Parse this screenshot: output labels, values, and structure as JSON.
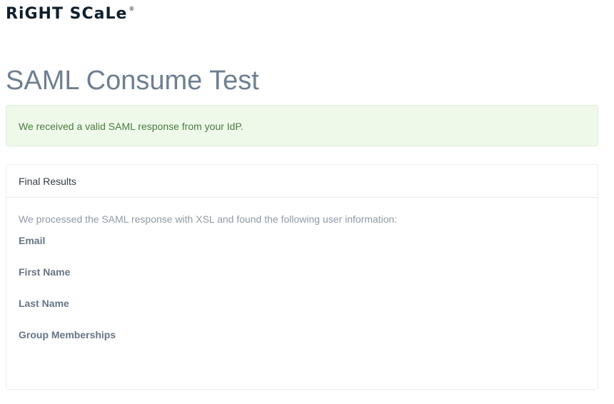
{
  "header": {
    "logo_text": "RiGHT SCaLe",
    "logo_mark": "®"
  },
  "page": {
    "title": "SAML Consume Test"
  },
  "alert": {
    "message": "We received a valid SAML response from your IdP."
  },
  "results_panel": {
    "heading": "Final Results",
    "intro": "We processed the SAML response with XSL and found the following user information:",
    "fields": [
      {
        "label": "Email",
        "value": ""
      },
      {
        "label": "First Name",
        "value": ""
      },
      {
        "label": "Last Name",
        "value": ""
      },
      {
        "label": "Group Memberships",
        "value": ""
      }
    ]
  },
  "colors": {
    "title": "#6e7f91",
    "alert_bg": "#eef9ea",
    "alert_text": "#4b7a3f",
    "label": "#667585"
  }
}
